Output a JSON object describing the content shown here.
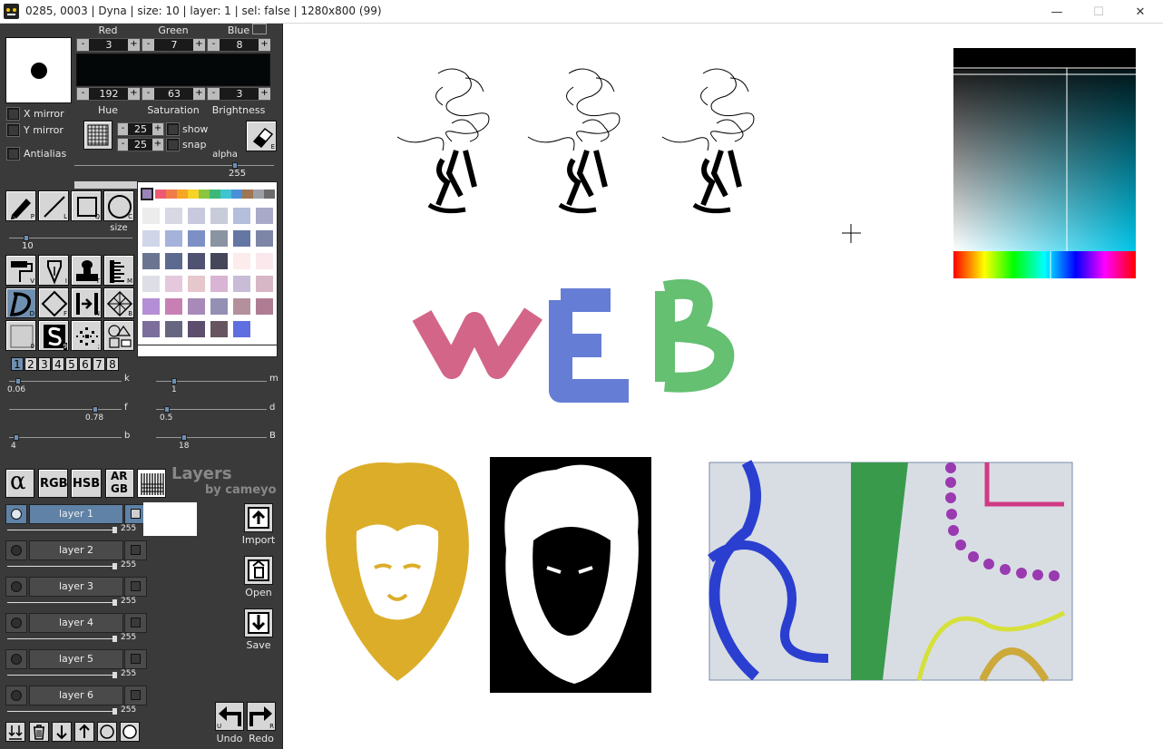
{
  "window": {
    "title": "0285, 0003 | Dyna | size: 10 | layer: 1 | sel: false | 1280x800 (99)",
    "minimize": "—",
    "maximize": "☐",
    "close": "✕"
  },
  "color": {
    "red_label": "Red",
    "green_label": "Green",
    "blue_label": "Blue",
    "hue_label": "Hue",
    "saturation_label": "Saturation",
    "brightness_label": "Brightness",
    "red": "3",
    "green": "7",
    "blue": "8",
    "hue": "192",
    "saturation": "63",
    "brightness": "3",
    "current": "#030708"
  },
  "options": {
    "x_mirror": "X mirror",
    "y_mirror": "Y mirror",
    "antialias": "Antialias",
    "grid_x": "25",
    "grid_y": "25",
    "show": "show",
    "snap": "snap",
    "alpha_label": "alpha",
    "alpha_value": "255",
    "alpha_level": 1.0,
    "size_label": "size",
    "size_value": "10"
  },
  "tools": {
    "pencil_key": "P",
    "line_key": "L",
    "rect_key": "Q",
    "circle_key": "C",
    "fill_key": "V",
    "pen_key": "I",
    "stamp_key": "T",
    "ruler_key": "M",
    "dyna_key": "D",
    "diamond_key": "F",
    "mirror_key": "N",
    "spiro_key": "B",
    "blank_key": "0",
    "symmetry_key": "9",
    "spray_key": ";",
    "shapes_key": "",
    "eraser_key": "E"
  },
  "palette": {
    "selected": "#9b82b8",
    "strip": [
      "#ee5a73",
      "#f07c4a",
      "#f5a623",
      "#f5d327",
      "#8cc63f",
      "#3cb878",
      "#3fc4d1",
      "#4a90d9",
      "#a07552",
      "#9aa0a6",
      "#6b6b6b"
    ],
    "swatches": [
      "#ececec",
      "#d8d8e4",
      "#c9c9de",
      "#c8cbd8",
      "#b4bedd",
      "#a9a9c9",
      "#d0d6e8",
      "#a5b2d9",
      "#7d90c6",
      "#8a93a2",
      "#6476a3",
      "#7d86a6",
      "#6b7591",
      "#5c6a8f",
      "#4f5270",
      "#46465a",
      "#fcecec",
      "#fae8ec",
      "#dedee6",
      "#e6c8dc",
      "#e6c8cc",
      "#d9b4d4",
      "#c8bcd6",
      "#d7b6c6",
      "#b48ed6",
      "#c880b4",
      "#a88ab8",
      "#9490b4",
      "#b4909c",
      "#b07c94",
      "#7b6e9c",
      "#676680",
      "#5c4e6c",
      "#665560",
      "#5f6fe0",
      "#ffffff"
    ]
  },
  "brushes": {
    "tabs": [
      "1",
      "2",
      "3",
      "4",
      "5",
      "6",
      "7",
      "8"
    ],
    "k_label": "k",
    "k_value": "0.06",
    "k_level": 0.06,
    "m_label": "m",
    "m_value": "1",
    "m_level": 0.15,
    "f_label": "f",
    "f_value": "0.78",
    "f_level": 0.78,
    "d_label": "d",
    "d_value": "0.5",
    "d_level": 0.08,
    "b_label": "b",
    "b_value": "4",
    "b_level": 0.04,
    "B_label": "B",
    "B_value": "18",
    "B_level": 0.24
  },
  "modes": {
    "alpha": "α",
    "rgb": "RGB",
    "hsb": "HSB",
    "argb_top": "AR",
    "argb_bottom": "GB"
  },
  "layers": {
    "header": "Layers",
    "by": "by cameyo",
    "items": [
      {
        "name": "layer 1",
        "alpha": "255"
      },
      {
        "name": "layer 2",
        "alpha": "255"
      },
      {
        "name": "layer 3",
        "alpha": "255"
      },
      {
        "name": "layer 4",
        "alpha": "255"
      },
      {
        "name": "layer 5",
        "alpha": "255"
      },
      {
        "name": "layer 6",
        "alpha": "255"
      }
    ]
  },
  "actions": {
    "import": "Import",
    "open": "Open",
    "save": "Save",
    "undo": "Undo",
    "redo": "Redo",
    "undo_key": "U",
    "redo_key": "R"
  },
  "canvas": {
    "web_text": "WEB"
  }
}
